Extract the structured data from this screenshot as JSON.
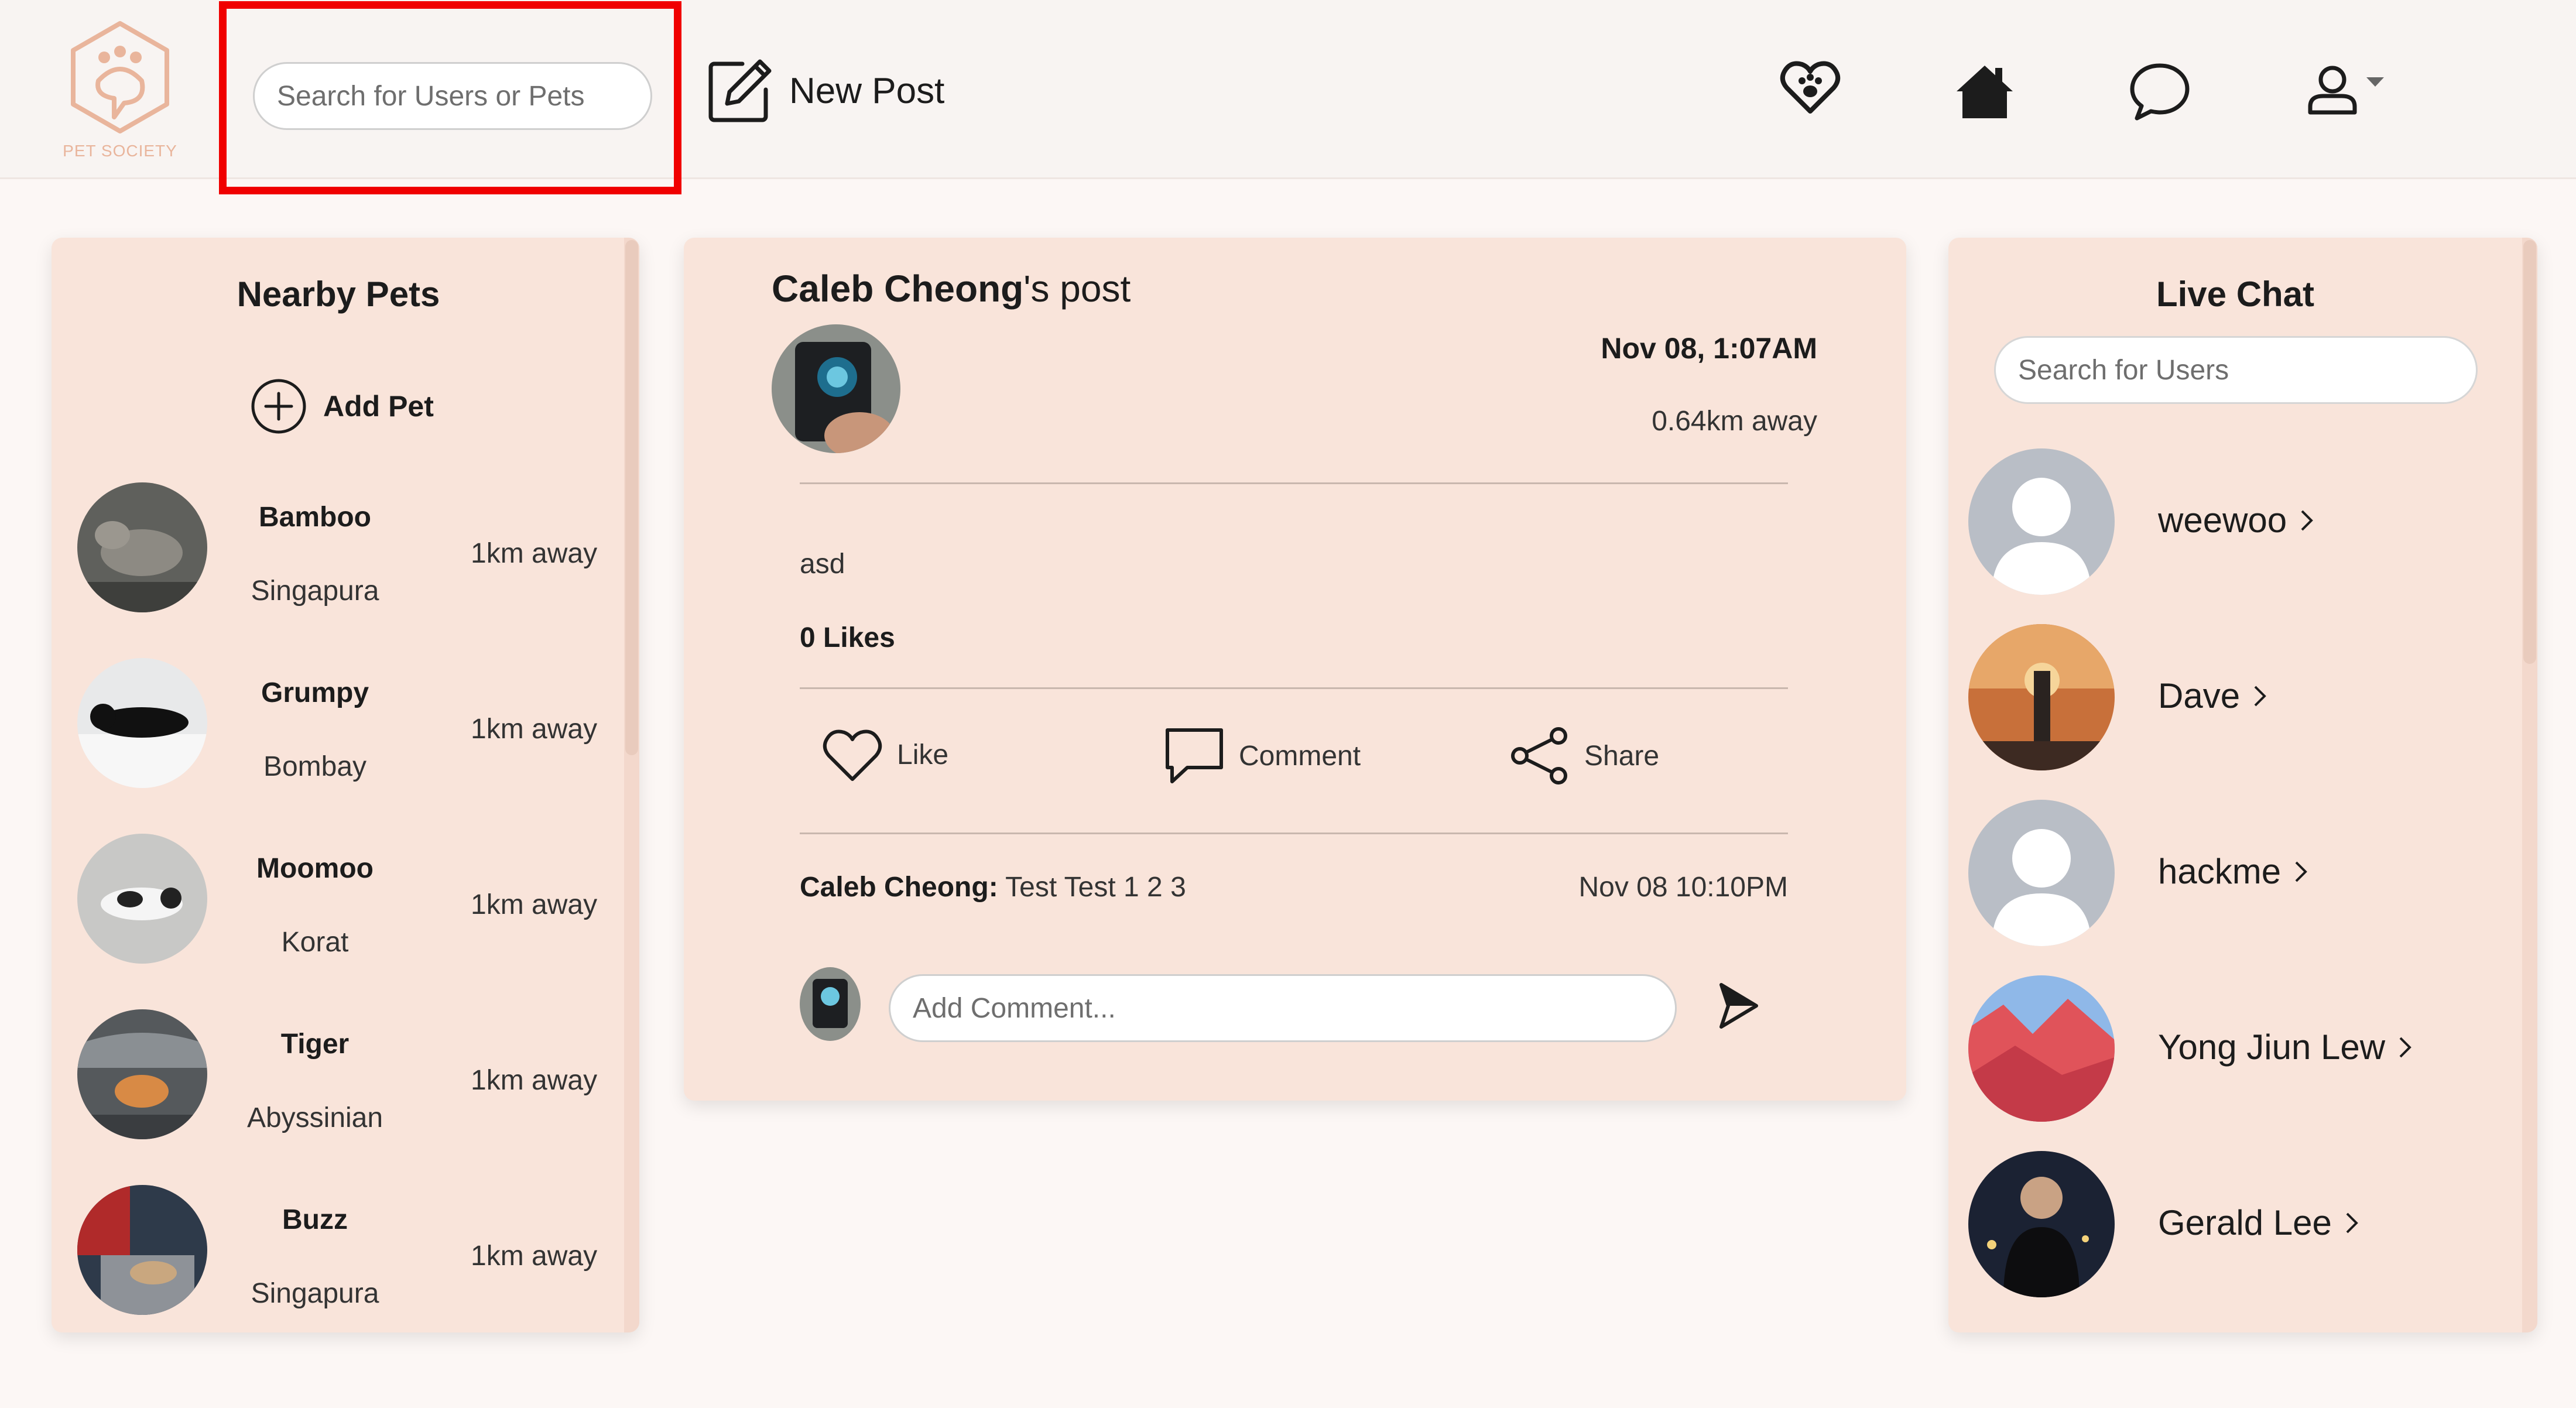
{
  "brand": {
    "name": "PET SOCIETY",
    "color": "#e9b59c"
  },
  "header": {
    "search_placeholder": "Search for Users or Pets",
    "new_post_label": "New Post",
    "icons": [
      "paw-heart-icon",
      "home-icon",
      "chat-bubble-icon",
      "user-icon",
      "caret-down-icon"
    ],
    "highlight_color": "#f00000"
  },
  "pets_panel": {
    "title": "Nearby Pets",
    "add_label": "Add Pet",
    "pets": [
      {
        "name": "Bamboo",
        "breed": "Singapura",
        "distance": "1km away"
      },
      {
        "name": "Grumpy",
        "breed": "Bombay",
        "distance": "1km away"
      },
      {
        "name": "Moomoo",
        "breed": "Korat",
        "distance": "1km away"
      },
      {
        "name": "Tiger",
        "breed": "Abyssinian",
        "distance": "1km away"
      },
      {
        "name": "Buzz",
        "breed": "Singapura",
        "distance": "1km away"
      }
    ]
  },
  "post": {
    "author": "Caleb Cheong",
    "title_suffix": "'s post",
    "date": "Nov 08, 1:07AM",
    "distance": "0.64km away",
    "body": "asd",
    "likes": "0 Likes",
    "actions": {
      "like": "Like",
      "comment": "Comment",
      "share": "Share"
    },
    "comment": {
      "author": "Caleb Cheong:",
      "text": "Test Test 1 2 3",
      "time": "Nov 08 10:10PM"
    },
    "comment_placeholder": "Add Comment..."
  },
  "chat_panel": {
    "title": "Live Chat",
    "search_placeholder": "Search for Users",
    "users": [
      {
        "name": "weewoo"
      },
      {
        "name": "Dave"
      },
      {
        "name": "hackme"
      },
      {
        "name": "Yong Jiun Lew"
      },
      {
        "name": "Gerald Lee"
      }
    ]
  },
  "colors": {
    "card_bg": "#f9e4da",
    "page_bg": "#fcf7f5",
    "header_bg": "#f8f4f2"
  }
}
